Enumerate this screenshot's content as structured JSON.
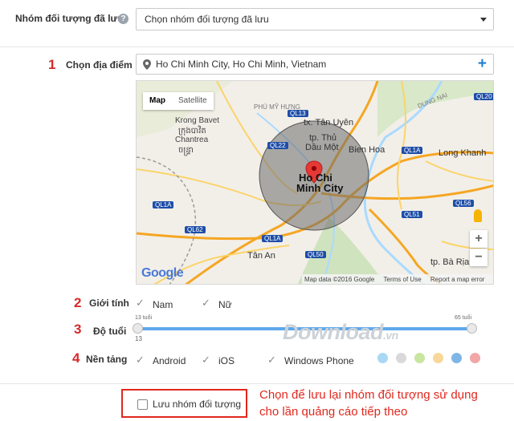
{
  "saved_group": {
    "label": "Nhóm đối tượng đã lưu",
    "help": "?",
    "select_value": "Chọn nhóm đối tượng đã lưu"
  },
  "location": {
    "step": "1",
    "label": "Chọn địa điểm",
    "value": "Ho Chi Minh City, Ho Chi Minh, Vietnam",
    "add": "+"
  },
  "map": {
    "tab_map": "Map",
    "tab_satellite": "Satellite",
    "center_label_1": "Ho Chi",
    "center_label_2": "Minh City",
    "places": [
      "Krong Bavet",
      "ក្រុងបាវិត",
      "Chantrea",
      "ចន្ទ្រា",
      "tx. Tân Uyên",
      "tp. Thủ",
      "Dầu Một",
      "Bien Hoa",
      "Long Khanh",
      "Tân An",
      "tp. Bà Rịa",
      "PHÚ MỸ HƯNG",
      "DUNG NAI"
    ],
    "roads": [
      "QL22",
      "QL1A",
      "QL62",
      "QL1A",
      "QL50",
      "QL51",
      "QL56",
      "QL20",
      "QL13",
      "QL1A"
    ],
    "zoom_in": "+",
    "zoom_out": "−",
    "google": "Google",
    "attribution": "Map data ©2016 Google",
    "terms": "Terms of Use",
    "report": "Report a map error"
  },
  "gender": {
    "step": "2",
    "label": "Giới tính",
    "options": [
      "Nam",
      "Nữ"
    ]
  },
  "age": {
    "step": "3",
    "label": "Độ tuổi",
    "min_label": "13 tuổi",
    "max_label": "65 tuổi",
    "min_value": "13",
    "range": [
      13,
      65
    ]
  },
  "platform": {
    "step": "4",
    "label": "Nền tảng",
    "options": [
      "Android",
      "iOS",
      "Windows Phone"
    ]
  },
  "watermark": "Download",
  "watermark_suffix": ".vn",
  "dot_colors": [
    "#a9d8f5",
    "#d9d9d9",
    "#c8e6a0",
    "#f8d79a",
    "#7fb6e6",
    "#f2a6a6"
  ],
  "save": {
    "label": "Lưu nhóm đối tượng"
  },
  "annotation": {
    "line1": "Chọn để lưu lại nhóm đối tượng sử dụng",
    "line2": "cho lần quảng cáo tiếp theo"
  },
  "colors": {
    "accent": "#1e7fd6",
    "annotation": "#e0281e"
  }
}
